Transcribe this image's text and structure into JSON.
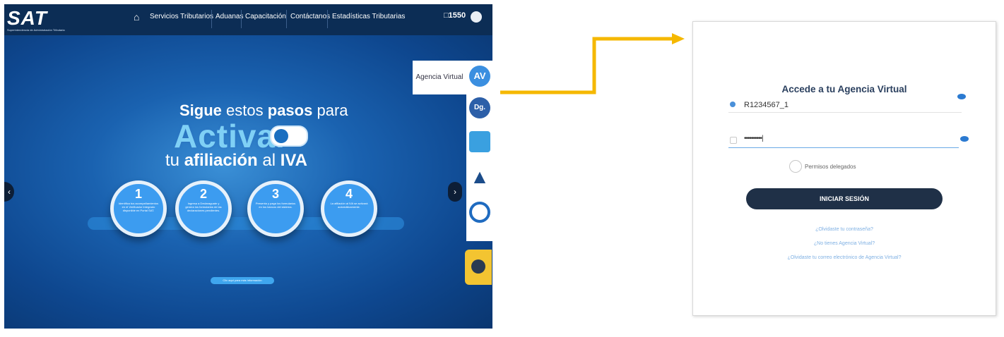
{
  "portal": {
    "logo_text": "SAT",
    "logo_subtext": "Superintendencia de Administración Tributaria",
    "nav": [
      "Servicios Tributarios",
      "Aduanas",
      "Capacitación",
      "Contáctanos",
      "Estadísticas Tributarias"
    ],
    "phone": "1550",
    "hero": {
      "line1_bold": "Sigue",
      "line1_normal": "estos",
      "line1_bold2": "pasos",
      "line1_normal2": "para",
      "line2": "Activar",
      "line3_normal": "tu",
      "line3_bold": "afiliación",
      "line3_normal2": "al",
      "line3_bold2": "IVA"
    },
    "steps": [
      {
        "num": "1",
        "text": "Identifica tus acompañamientos en el Verificador Integrado disponible en Portal SAT."
      },
      {
        "num": "2",
        "text": "Ingresa a Declaraguate y genera los formularios de las declaraciones pendientes."
      },
      {
        "num": "3",
        "text": "Presenta y paga los formularios en los bancos del sistema."
      },
      {
        "num": "4",
        "text": "La afiliación al IVA se activará automáticamente."
      }
    ],
    "more_button": "Clic aquí para más información",
    "side_label": "Agencia Virtual",
    "side_icons": [
      "AV",
      "Dg.",
      "person-icon",
      "alert-icon",
      "search-icon"
    ]
  },
  "login": {
    "title": "Accede a tu Agencia Virtual",
    "username": "R1234567_1",
    "password_mask": "••••••••••|",
    "delegated_permissions": "Permisos delegados",
    "submit": "INICIAR SESIÓN",
    "links": [
      "¿Olvidaste tu contraseña?",
      "¿No tienes Agencia Virtual?",
      "¿Olvidaste tu correo electrónico de Agencia Virtual?"
    ]
  },
  "colors": {
    "arrow": "#f5b800",
    "nav_bg": "#0c2d55",
    "button_dark": "#1f3047"
  }
}
